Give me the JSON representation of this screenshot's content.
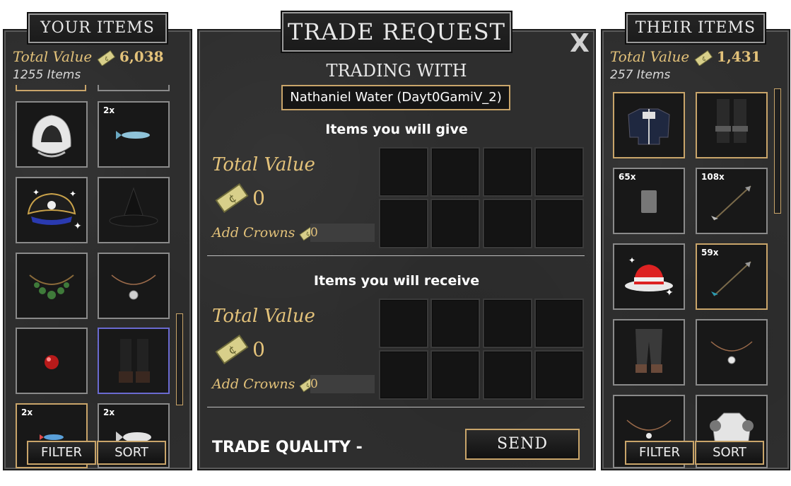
{
  "left": {
    "title": "YOUR ITEMS",
    "total_label": "Total Value",
    "total_value": "6,038",
    "count": "1255 Items",
    "filter": "FILTER",
    "sort": "SORT",
    "items": [
      {
        "name": "white-hood",
        "qty": ""
      },
      {
        "name": "blue-fish",
        "qty": "2x"
      },
      {
        "name": "pirate-hat",
        "qty": ""
      },
      {
        "name": "witch-hat",
        "qty": ""
      },
      {
        "name": "green-amulet",
        "qty": ""
      },
      {
        "name": "silver-amulet",
        "qty": ""
      },
      {
        "name": "red-orb",
        "qty": ""
      },
      {
        "name": "leather-boots",
        "qty": ""
      },
      {
        "name": "small-fish",
        "qty": "2x"
      },
      {
        "name": "white-fish",
        "qty": "2x"
      }
    ]
  },
  "center": {
    "title": "TRADE REQUEST",
    "close": "X",
    "trading_with_label": "TRADING WITH",
    "partner": "Nathaniel Water (Dayt0GamiV_2)",
    "give_title": "Items you will give",
    "receive_title": "Items you will receive",
    "total_label": "Total Value",
    "give_value": "0",
    "receive_value": "0",
    "add_crowns_label": "Add Crowns",
    "give_crowns": "0",
    "receive_crowns": "0",
    "trade_quality": "TRADE QUALITY -",
    "send": "SEND"
  },
  "right": {
    "title": "THEIR ITEMS",
    "total_label": "Total Value",
    "total_value": "1,431",
    "count": "257 Items",
    "filter": "FILTER",
    "sort": "SORT",
    "items": [
      {
        "name": "blue-coat",
        "qty": ""
      },
      {
        "name": "dark-boots",
        "qty": ""
      },
      {
        "name": "gray-card",
        "qty": "65x"
      },
      {
        "name": "arrow",
        "qty": "108x"
      },
      {
        "name": "red-hat",
        "qty": ""
      },
      {
        "name": "teal-arrow",
        "qty": "59x"
      },
      {
        "name": "dark-pants",
        "qty": ""
      },
      {
        "name": "necklace",
        "qty": ""
      },
      {
        "name": "bow-necklace",
        "qty": ""
      },
      {
        "name": "white-armor",
        "qty": ""
      }
    ]
  },
  "colors": {
    "gold": "#c9a56a",
    "value_text": "#e3c27a",
    "panel": "#2e2e2e"
  }
}
